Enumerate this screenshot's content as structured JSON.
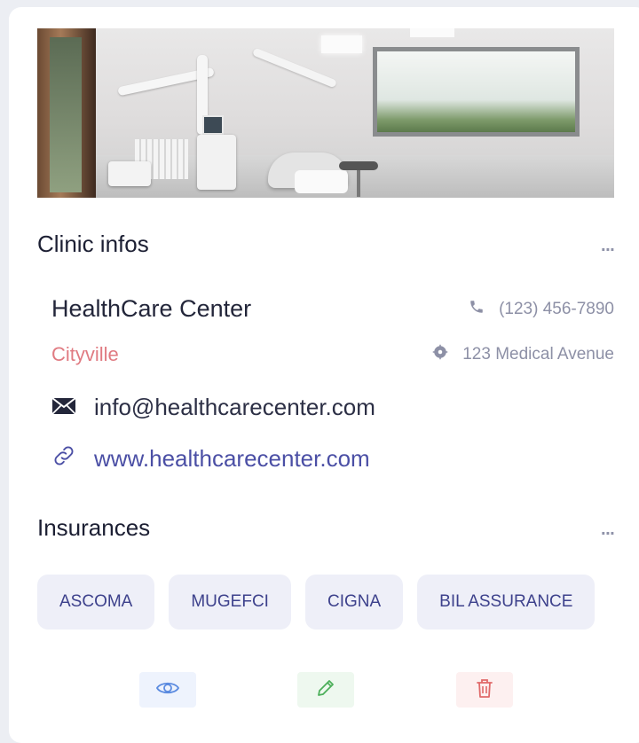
{
  "clinic_section": {
    "title": "Clinic infos",
    "name": "HealthCare Center",
    "phone": "(123) 456-7890",
    "city": "Cityville",
    "address": "123 Medical Avenue",
    "email": "info@healthcarecenter.com",
    "website": "www.healthcarecenter.com",
    "more_label": "···"
  },
  "insurances_section": {
    "title": "Insurances",
    "more_label": "···",
    "items": [
      {
        "label": "ASCOMA"
      },
      {
        "label": "MUGEFCI"
      },
      {
        "label": "CIGNA"
      },
      {
        "label": "BIL ASSURANCE"
      }
    ]
  },
  "actions": [
    {
      "icon": "eye-icon",
      "color": "#5b8be0"
    },
    {
      "icon": "pencil-icon",
      "color": "#4caf5a"
    },
    {
      "icon": "trash-icon",
      "color": "#e06a6a"
    }
  ],
  "colors": {
    "accent": "#4b4fa5",
    "city": "#e07b82",
    "chip_bg": "#eeeff8"
  }
}
